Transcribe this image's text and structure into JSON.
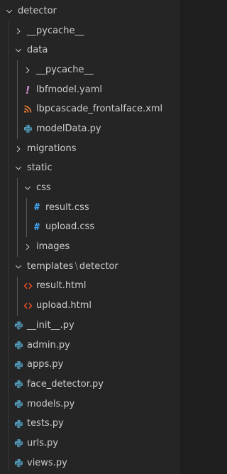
{
  "explorer": {
    "items": [
      {
        "label": "detector",
        "type": "folder",
        "open": true,
        "depth": 0
      },
      {
        "label": "__pycache__",
        "type": "folder",
        "open": false,
        "depth": 1
      },
      {
        "label": "data",
        "type": "folder",
        "open": true,
        "depth": 1
      },
      {
        "label": "__pycache__",
        "type": "folder",
        "open": false,
        "depth": 2
      },
      {
        "label": "lbfmodel.yaml",
        "type": "file",
        "icon": "yaml-icon",
        "depth": 2
      },
      {
        "label": "lbpcascade_frontalface.xml",
        "type": "file",
        "icon": "xml-icon",
        "depth": 2
      },
      {
        "label": "modelData.py",
        "type": "file",
        "icon": "python-icon",
        "depth": 2
      },
      {
        "label": "migrations",
        "type": "folder",
        "open": false,
        "depth": 1
      },
      {
        "label": "static",
        "type": "folder",
        "open": true,
        "depth": 1
      },
      {
        "label": "css",
        "type": "folder",
        "open": true,
        "depth": 2
      },
      {
        "label": "result.css",
        "type": "file",
        "icon": "css-icon",
        "depth": 3
      },
      {
        "label": "upload.css",
        "type": "file",
        "icon": "css-icon",
        "depth": 3
      },
      {
        "label": "images",
        "type": "folder",
        "open": false,
        "depth": 2
      },
      {
        "label": "templates",
        "label_suffix": "detector",
        "separator": "\\",
        "type": "folder",
        "open": true,
        "depth": 1
      },
      {
        "label": "result.html",
        "type": "file",
        "icon": "html-icon",
        "depth": 2
      },
      {
        "label": "upload.html",
        "type": "file",
        "icon": "html-icon",
        "depth": 2
      },
      {
        "label": "__init__.py",
        "type": "file",
        "icon": "python-icon",
        "depth": 1
      },
      {
        "label": "admin.py",
        "type": "file",
        "icon": "python-icon",
        "depth": 1
      },
      {
        "label": "apps.py",
        "type": "file",
        "icon": "python-icon",
        "depth": 1
      },
      {
        "label": "face_detector.py",
        "type": "file",
        "icon": "python-icon",
        "depth": 1
      },
      {
        "label": "models.py",
        "type": "file",
        "icon": "python-icon",
        "depth": 1
      },
      {
        "label": "tests.py",
        "type": "file",
        "icon": "python-icon",
        "depth": 1
      },
      {
        "label": "urls.py",
        "type": "file",
        "icon": "python-icon",
        "depth": 1
      },
      {
        "label": "views.py",
        "type": "file",
        "icon": "python-icon",
        "depth": 1
      }
    ]
  },
  "colors": {
    "yaml": "#c586c0",
    "xml": "#e37933",
    "python": "#519aba",
    "css": "#42a5f5",
    "html": "#e44d26",
    "chevron": "#c5c5c5"
  }
}
